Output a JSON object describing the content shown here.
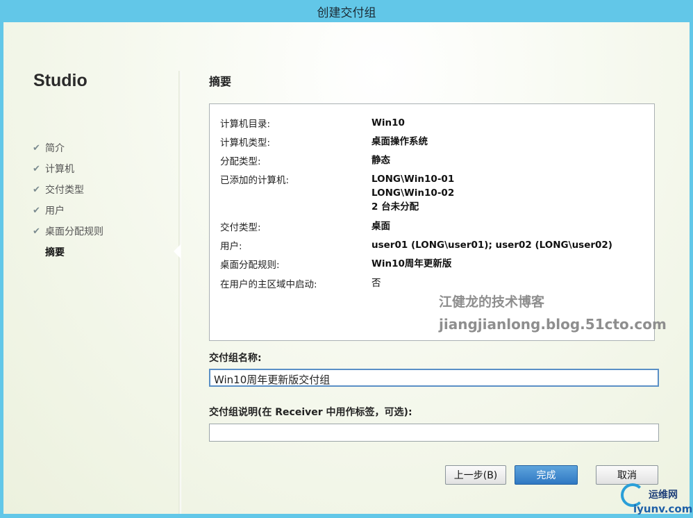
{
  "window": {
    "title": "创建交付组"
  },
  "sidebar": {
    "brand": "Studio",
    "steps": [
      {
        "label": "简介",
        "done": true
      },
      {
        "label": "计算机",
        "done": true
      },
      {
        "label": "交付类型",
        "done": true
      },
      {
        "label": "用户",
        "done": true
      },
      {
        "label": "桌面分配规则",
        "done": true
      },
      {
        "label": "摘要",
        "done": false,
        "active": true
      }
    ]
  },
  "summary": {
    "title": "摘要",
    "rows": [
      {
        "label": "计算机目录:",
        "value": "Win10"
      },
      {
        "label": "计算机类型:",
        "value": "桌面操作系统"
      },
      {
        "label": "分配类型:",
        "value": "静态"
      },
      {
        "label": "已添加的计算机:",
        "value_lines": [
          "LONG\\Win10-01",
          "LONG\\Win10-02",
          "2 台未分配"
        ]
      },
      {
        "label": "交付类型:",
        "value": "桌面"
      },
      {
        "label": "用户:",
        "value": "user01 (LONG\\user01); user02 (LONG\\user02)"
      },
      {
        "label": "桌面分配规则:",
        "value": "Win10周年更新版"
      },
      {
        "label": "在用户的主区域中启动:",
        "value": "否"
      }
    ],
    "watermark_title": "江健龙的技术博客",
    "watermark_url": "jiangjianlong.blog.51cto.com"
  },
  "form": {
    "name_label": "交付组名称:",
    "name_value": "Win10周年更新版交付组",
    "desc_label": "交付组说明(在 Receiver 中用作标签，可选):",
    "desc_value": ""
  },
  "buttons": {
    "back": "上一步(B)",
    "finish": "完成",
    "cancel": "取消"
  },
  "footer_logo": {
    "line1": "运维网",
    "line2": "iyunv.com"
  },
  "colors": {
    "titlebar": "#62c7e8",
    "primary_button": "#3b86cf"
  }
}
